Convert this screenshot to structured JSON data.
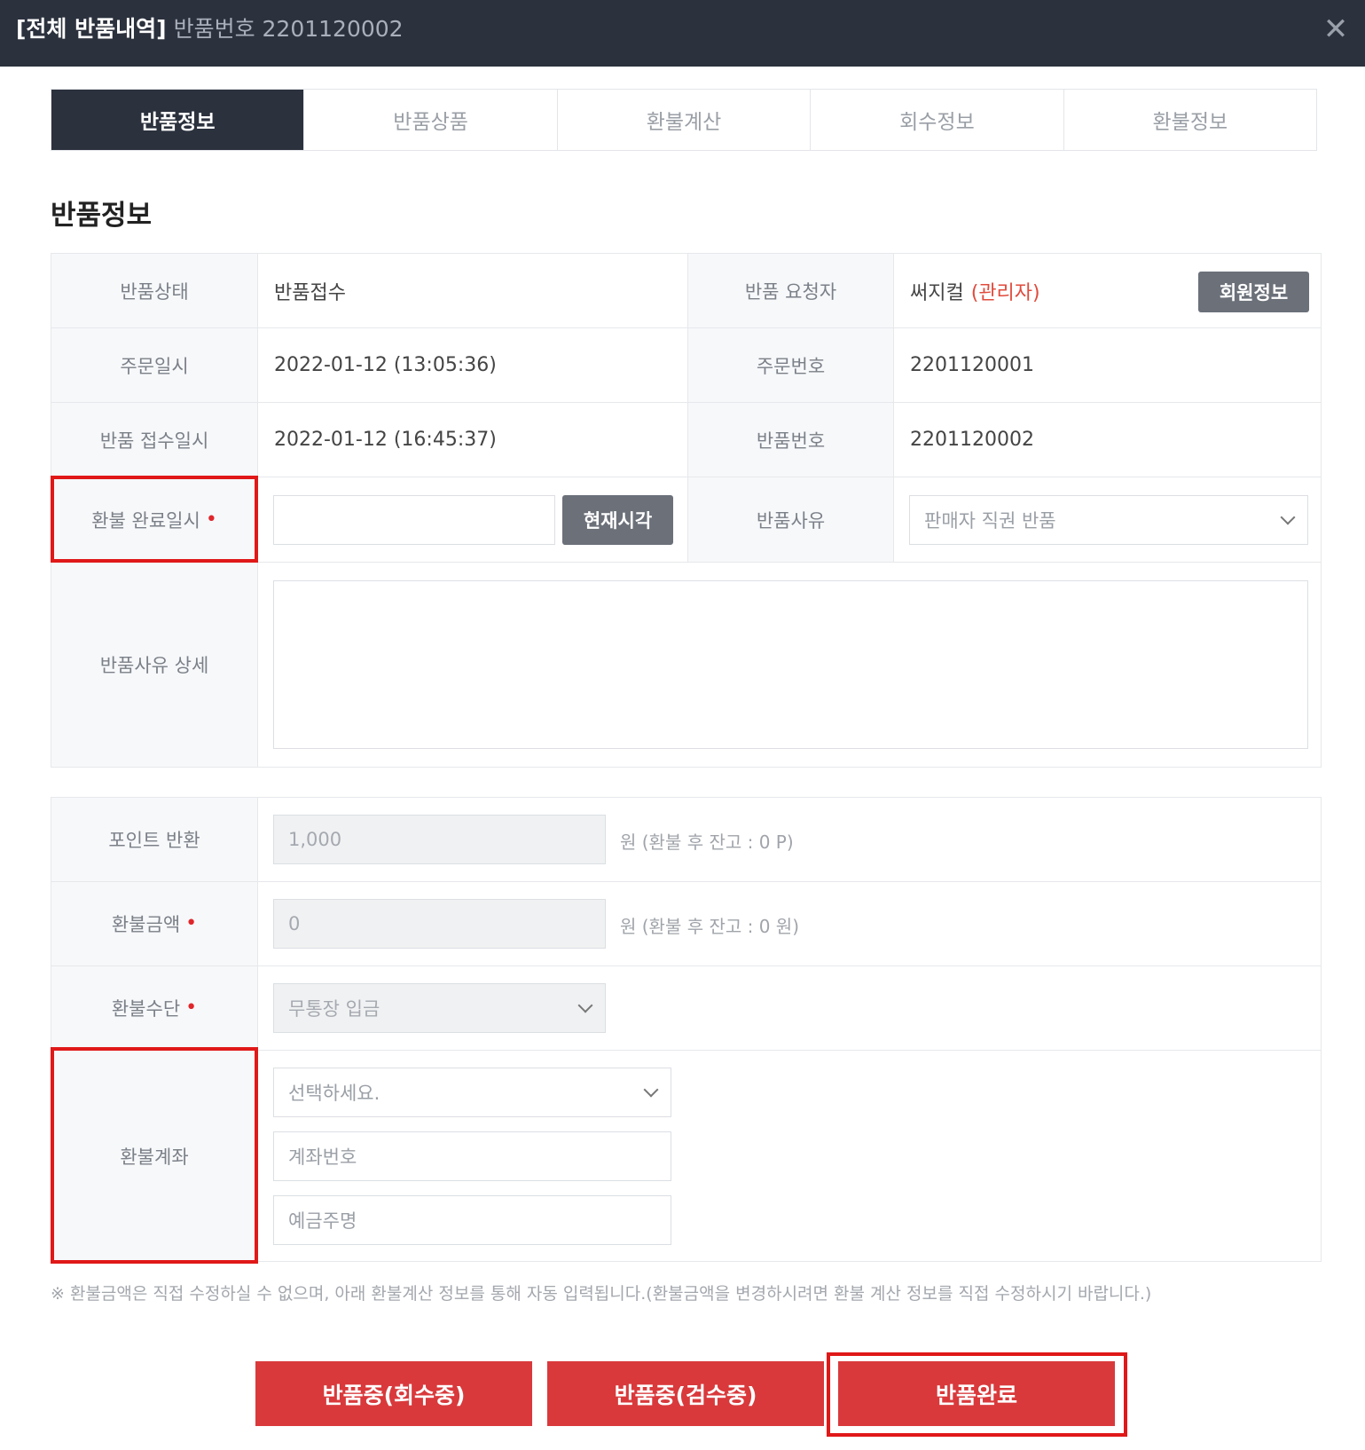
{
  "titlebar": {
    "title_bold": "[전체 반품내역]",
    "title_sub": "반품번호 2201120002",
    "close_glyph": "✕"
  },
  "tabs": [
    {
      "label": "반품정보",
      "active": true
    },
    {
      "label": "반품상품",
      "active": false
    },
    {
      "label": "환불계산",
      "active": false
    },
    {
      "label": "회수정보",
      "active": false
    },
    {
      "label": "환불정보",
      "active": false
    }
  ],
  "section_title": "반품정보",
  "info": {
    "status_label": "반품상태",
    "status_value": "반품접수",
    "requester_label": "반품 요청자",
    "requester_name": "써지컬",
    "requester_role": "(관리자)",
    "member_info_button": "회원정보",
    "order_date_label": "주문일시",
    "order_date_value": "2022-01-12 (13:05:36)",
    "order_no_label": "주문번호",
    "order_no_value": "2201120001",
    "receipt_date_label": "반품 접수일시",
    "receipt_date_value": "2022-01-12 (16:45:37)",
    "return_no_label": "반품번호",
    "return_no_value": "2201120002",
    "refund_done_label": "환불 완료일시",
    "refund_done_value": "",
    "now_button": "현재시각",
    "reason_label": "반품사유",
    "reason_value": "판매자 직권 반품",
    "reason_detail_label": "반품사유 상세",
    "reason_detail_value": ""
  },
  "refund": {
    "point_label": "포인트 반환",
    "point_value": "1,000",
    "point_hint": "원 (환불 후 잔고 : 0 P)",
    "amount_label": "환불금액",
    "amount_value": "0",
    "amount_hint": "원 (환불 후 잔고 : 0 원)",
    "method_label": "환불수단",
    "method_value": "무통장 입금",
    "account_label": "환불계좌",
    "bank_placeholder": "선택하세요.",
    "account_no_placeholder": "계좌번호",
    "holder_placeholder": "예금주명"
  },
  "required_mark": "•",
  "note": "※ 환불금액은 직접 수정하실 수 없으며, 아래 환불계산 정보를 통해 자동 입력됩니다.(환불금액을 변경하시려면 환불 계산 정보를 직접 수정하시기 바랍니다.)",
  "actions": {
    "collecting": "반품중(회수중)",
    "inspecting": "반품중(검수중)",
    "complete": "반품완료"
  },
  "colors": {
    "header_bg": "#2b313d",
    "action_red": "#d9393b",
    "highlight_red": "#e01818",
    "role_red": "#e04b3c"
  }
}
